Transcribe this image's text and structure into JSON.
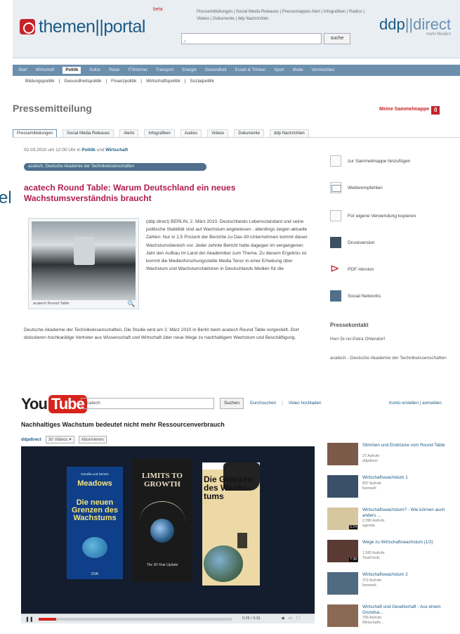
{
  "themenportal": {
    "logo_text": "themen||portal",
    "beta": "beta",
    "top_links": "Pressemitteilungen | Social Media Releases | Pressemappen  Alert | Infografiken | Radios | Videos | Dokumente | ddp Nachrichten",
    "search_placeholder": "",
    "search_button": "suche",
    "ddp_brand_a": "ddp",
    "ddp_brand_b": "direct",
    "ddp_tagline": "mehr Medien",
    "nav": [
      "Start",
      "Wirtschaft",
      "Politik",
      "Kultur",
      "Reise",
      "IT/Internet",
      "Transport",
      "Energie",
      "Gesundheit",
      "Essen & Trinken",
      "Sport",
      "Mode",
      "Vermischtes"
    ],
    "nav_active": "Politik",
    "subnav": [
      "Bildungspolitik",
      "Gesundheitspolitik",
      "Finanzpolitik",
      "Wirtschaftspolitik",
      "Sozialpolitik"
    ],
    "page_heading": "Pressemitteilung",
    "merkzettel": "Meine Sammelmappe",
    "merkzettel_badge": "0",
    "tabs": [
      "Pressemitteilungen",
      "Social Media Releases",
      "Alerts",
      "Infografiken",
      "Audios",
      "Videos",
      "Dokumente",
      "ddp Nachrichten"
    ],
    "date_line_prefix": "02.03.2010 um 12:00 Uhr in",
    "date_line_cat1": "Politik",
    "date_line_and": "und",
    "date_line_cat2": "Wirtschaft",
    "tags_line": "acatech, Deutsche Akademie der Technikwissenschaften",
    "left_fragment": "el",
    "title": "acatech Round Table: Warum Deutschland ein neues Wachstumsverständnis braucht",
    "photo_caption": "acatech Round Table",
    "body": "(ddp direct) BERLIN, 2. März 2010. Deutschlands Lebensstandard und seine politische Stabilität sind auf Wachstum angewiesen - allerdings zeigen aktuelle Zahlen: Nur in 2,5 Prozent der Berichte zu Dax-30-Unternehmen kommt dieser Wachstumsbereich vor. Jeder zehnte Bericht hatte dagegen im vergangenen Jahr den Aufbau im Land der Akademiker zum Thema. Zu diesem Ergebnis ist kommt die Medienforschungsstelle Media Tenor in einer Erhebung über Wachstum und Wachstumsfaktoren in Deutschlands Medien für die",
    "body_cont": "Deutsche Akademie der Technikwissenschaften. Die Studie wird am 2. März 2010 in Berlin beim acatech Round Table vorgestellt. Dort diskutieren hochkarätige Vertreter aus Wissenschaft und Wirtschaft über neue Wege zu nachhaltigem Wachstum und Beschäftigung.",
    "side_actions": [
      "zur Sammelmappe hinzufügen",
      "Weiterempfehlen",
      "Für eigene Verwendung kopieren",
      "Druckversion",
      "PDF-Version",
      "Social Networks"
    ],
    "kontakt_heading": "Pressekontakt",
    "kontakt_name": "Herr Dr.rer.Petra Ohlendorf",
    "kontakt_org": "acatech - Deutsche Akademie der Technikwissenschaften"
  },
  "youtube": {
    "logo_you": "You",
    "logo_tube": "Tube",
    "search_value": "acatech",
    "search_button": "Suchen",
    "browse_link": "Durchsuchen",
    "upload_link": "Video hochladen",
    "account_links": "Konto erstellen | anmelden",
    "video_title": "Nachhaltiges Wachstum bedeutet nicht mehr Ressourcenverbrauch",
    "channel_name": "ddpdirect",
    "video_count": "30 Videos",
    "subscribe": "Abonnieren",
    "book1_author_small": "Donella und Dennis",
    "book1_author": "Meadows",
    "book1_title": "Die neuen Grenzen des Wachstums",
    "book1_publisher": "DVA",
    "book2_title": "LIMITS TO GROWTH",
    "book2_subtitle": "The 30-Year Update",
    "book3_title": "Die Grenzen des Wachs-tums",
    "time_display": "0:25 / 3:31",
    "progress": 0.09,
    "related": [
      {
        "title": "Stimmen und Eindrücke vom Round Table",
        "views": "37 Aufrufe",
        "user": "ddpdirect",
        "duration": ""
      },
      {
        "title": "Wirtschaftswachstum 1",
        "views": "897 Aufrufe",
        "user": "funnwelt",
        "duration": ""
      },
      {
        "title": "Wirtschaftswachstum? - Wie können auch anders ...",
        "views": "2.390 Aufrufe",
        "user": "agenda",
        "duration": "5:24"
      },
      {
        "title": "Wege zu Wirtschaftswachstum (1/2)",
        "views": "1.583 Aufrufe",
        "user": "TinaFrieds",
        "duration": "7:38"
      },
      {
        "title": "Wirtschaftswachstum 2",
        "views": "372 Aufrufe",
        "user": "funnwelt",
        "duration": ""
      },
      {
        "title": "Wirtschaft und Gesellschaft - Aus einem Grundsa...",
        "views": "766 Aufrufe",
        "user": "Wirtschafts...",
        "duration": ""
      }
    ]
  }
}
